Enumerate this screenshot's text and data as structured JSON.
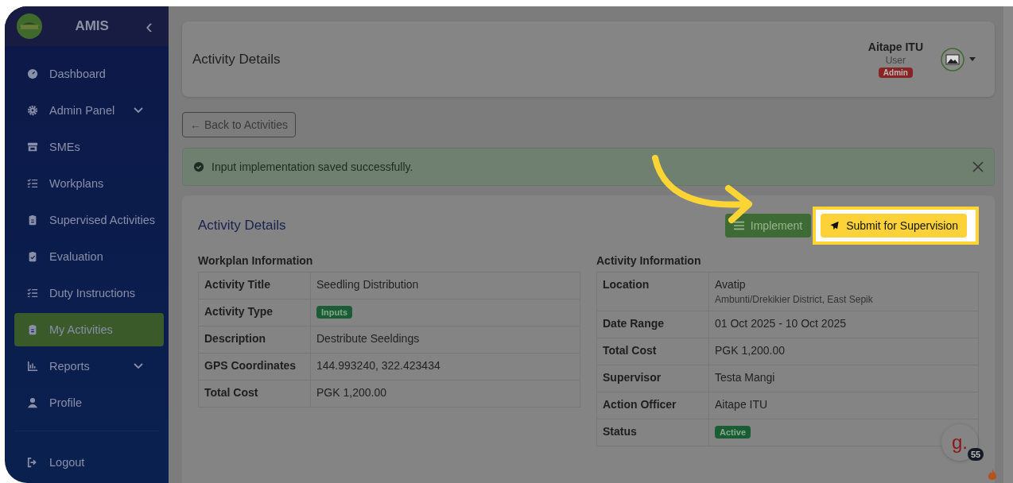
{
  "sidebar": {
    "brand": "AMIS",
    "collapse_icon": "‹",
    "items": [
      {
        "label": "Dashboard",
        "expandable": false,
        "selected": false
      },
      {
        "label": "Admin Panel",
        "expandable": true,
        "selected": false
      },
      {
        "label": "SMEs",
        "expandable": false,
        "selected": false
      },
      {
        "label": "Workplans",
        "expandable": false,
        "selected": false
      },
      {
        "label": "Supervised Activities",
        "expandable": false,
        "selected": false
      },
      {
        "label": "Evaluation",
        "expandable": false,
        "selected": false
      },
      {
        "label": "Duty Instructions",
        "expandable": false,
        "selected": false
      },
      {
        "label": "My Activities",
        "expandable": false,
        "selected": true
      },
      {
        "label": "Reports",
        "expandable": true,
        "selected": false
      },
      {
        "label": "Profile",
        "expandable": false,
        "selected": false
      }
    ],
    "logout": "Logout"
  },
  "header": {
    "title": "Activity Details",
    "user_name": "Aitape ITU",
    "user_role": "User",
    "badge": "Admin"
  },
  "back_button": "← Back to Activities",
  "alert": {
    "message": "Input implementation saved successfully."
  },
  "card": {
    "title": "Activity Details",
    "actions": [
      {
        "label": "Implement",
        "kind": "implement"
      },
      {
        "label": "Submit for Supervision",
        "kind": "submit"
      }
    ],
    "sections": [
      {
        "heading": "Workplan Information",
        "rows": [
          {
            "label": "Activity Title",
            "value": "Seedling Distribution",
            "kind": "text"
          },
          {
            "label": "Activity Type",
            "value": "Inputs",
            "kind": "badge"
          },
          {
            "label": "Description",
            "value": "Destribute Seeldings",
            "kind": "text"
          },
          {
            "label": "GPS Coordinates",
            "value": "144.993240, 322.423434",
            "kind": "text"
          },
          {
            "label": "Total Cost",
            "value": "PGK 1,200.00",
            "kind": "text"
          }
        ]
      },
      {
        "heading": "Activity Information",
        "rows": [
          {
            "label": "Location",
            "value": "Avatip",
            "sub": "Ambunti/Drekikier District, East Sepik",
            "kind": "text"
          },
          {
            "label": "Date Range",
            "value": "01 Oct 2025 - 10 Oct 2025",
            "kind": "text"
          },
          {
            "label": "Total Cost",
            "value": "PGK 1,200.00",
            "kind": "text"
          },
          {
            "label": "Supervisor",
            "value": "Testa Mangi",
            "kind": "text"
          },
          {
            "label": "Action Officer",
            "value": "Aitape ITU",
            "kind": "text"
          },
          {
            "label": "Status",
            "value": "Active",
            "kind": "badge"
          }
        ]
      }
    ]
  },
  "widget": {
    "letter": "g.",
    "count": "55"
  }
}
